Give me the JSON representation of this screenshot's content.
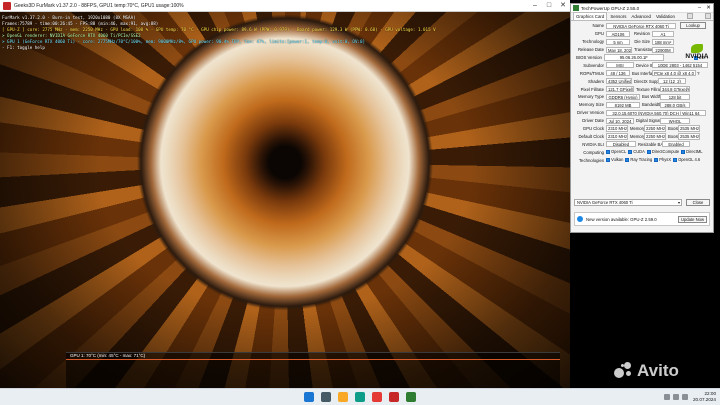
{
  "furmark": {
    "title": "Geeks3D FurMark v1.37.2.0 - 88FPS, GPU1 temp:70°C, GPU1 usage:100%",
    "overlay": [
      {
        "text": "FurMark v1.37.2.0 - Burn-in test, 1920x1080 (8X MSAA)",
        "color": "w"
      },
      {
        "text": "Frames:75789 - time:00:26:45 - FPS:88 (min:46, max:91, avg:88)",
        "color": "w"
      },
      {
        "text": "[ GPU-Z ] core: 2775 MHz - mem: 2250 MHz - GPU load: 100 % - GPU temp: 70 °C - GPU chip power: 89.6 W (PPW: 0.979) - Board power: 129.3 W (PPW: 0.68) - GPU voltage: 1.015 V",
        "color": "y"
      },
      {
        "text": "> OpenGL renderer: NVIDIA GeForce RTX 4060 Ti/PCIe/SSE2",
        "color": "g"
      },
      {
        "text": "> GPU 1 (GeForce RTX 4060 Ti) - core: 2775MHz/70°C/100%, mem: 9000MHz/8%, GPU power: 90.4% TDP, fan: 47%, limits:[power:1, temp:0, volt:0, OV:0]",
        "color": "c"
      },
      {
        "text": "- F1: toggle help",
        "color": "w"
      }
    ],
    "monitor_label": "GPU 1: 70°C (min: 45°C - max: 71°C)"
  },
  "gpuz": {
    "title": "TechPowerUp GPU-Z 2.55.0",
    "tabs": [
      "Graphics Card",
      "Sensors",
      "Advanced",
      "Validation"
    ],
    "name_label": "Name",
    "name_value": "NVIDIA GeForce RTX 4060 Ti",
    "lookup": "Lookup",
    "gpu_label": "GPU",
    "gpu_value": "AD106",
    "revision_label": "Revision",
    "revision_value": "A1",
    "tech_label": "Technology",
    "tech_value": "5 nm",
    "diesize_label": "Die Size",
    "diesize_value": "188 mm²",
    "release_label": "Release Date",
    "release_value": "May 18, 2023",
    "transistors_label": "Transistors",
    "transistors_value": "22900M",
    "bios_label": "BIOS Version",
    "bios_value": "95.06.26.00.1F",
    "uefi": "UEFI",
    "subvendor_label": "Subvendor",
    "subvendor_value": "MSI",
    "deviceid_label": "Device ID",
    "deviceid_value": "10DE 2803 - 1462 5154",
    "rops_label": "ROPs/TMUs",
    "rops_value": "48 / 136",
    "bus_label": "Bus Interface",
    "bus_value": "PCIe x8 4.0 @ x8 4.0",
    "shaders_label": "Shaders",
    "shaders_value": "4352 Unified",
    "dx_label": "DirectX Support",
    "dx_value": "12 (12_2)",
    "pixel_label": "Pixel Fillrate",
    "pixel_value": "121.7 GPixel/s",
    "texture_label": "Texture Fillrate",
    "texture_value": "344.8 GTexel/s",
    "memtype_label": "Memory Type",
    "memtype_value": "GDDR6 (Hynix)",
    "buswidth_label": "Bus Width",
    "buswidth_value": "128 bit",
    "memsize_label": "Memory Size",
    "memsize_value": "8192 MB",
    "bandwidth_label": "Bandwidth",
    "bandwidth_value": "288.0 GB/s",
    "driver_label": "Driver Version",
    "driver_value": "32.0.15.6070 (NVIDIA 560.70) DCH / Win11 64",
    "driverdate_label": "Driver Date",
    "driverdate_value": "Jul 10, 2024",
    "sig_label": "Digital Signature",
    "sig_value": "WHQL",
    "gpuclock_label": "GPU Clock",
    "gpuclock_value": "2310 MHz",
    "mem_label": "Memory",
    "mem_value": "2250 MHz",
    "boost_label": "Boost",
    "boost_value": "2535 MHz",
    "defclock_label": "Default Clock",
    "defclock_value": "2310 MHz",
    "defmem_value": "2250 MHz",
    "defboost_value": "2535 MHz",
    "sli_label": "NVIDIA SLI",
    "sli_value": "Disabled",
    "rebar_label": "Resizable BAR",
    "rebar_value": "Enabled",
    "computing_label": "Computing",
    "computing": [
      {
        "name": "OpenCL",
        "on": true
      },
      {
        "name": "CUDA",
        "on": true
      },
      {
        "name": "DirectCompute",
        "on": true
      },
      {
        "name": "DirectML",
        "on": true
      }
    ],
    "tech2_label": "Technologies",
    "technologies": [
      {
        "name": "Vulkan",
        "on": true
      },
      {
        "name": "Ray Tracing",
        "on": true
      },
      {
        "name": "PhysX",
        "on": true
      },
      {
        "name": "OpenGL 4.6",
        "on": true
      }
    ],
    "nvidia_word": "NVIDIA",
    "selector": "NVIDIA GeForce RTX 4060 Ti",
    "close": "Close",
    "update_msg": "New version available: GPU-Z 2.59.0",
    "update_btn": "Update Now"
  },
  "taskbar": {
    "apps": [
      {
        "icon": "windows-start-icon",
        "color": "#1976d2"
      },
      {
        "icon": "search-icon",
        "color": "#455a64"
      },
      {
        "icon": "file-explorer-icon",
        "color": "#f9a825"
      },
      {
        "icon": "edge-browser-icon",
        "color": "#0f9d8a"
      },
      {
        "icon": "chrome-browser-icon",
        "color": "#e53935"
      },
      {
        "icon": "furmark-icon",
        "color": "#c62828"
      },
      {
        "icon": "gpuz-icon",
        "color": "#2e7d32"
      }
    ],
    "time": "22:00",
    "date": "20.07.2024"
  },
  "watermark": "Avito"
}
